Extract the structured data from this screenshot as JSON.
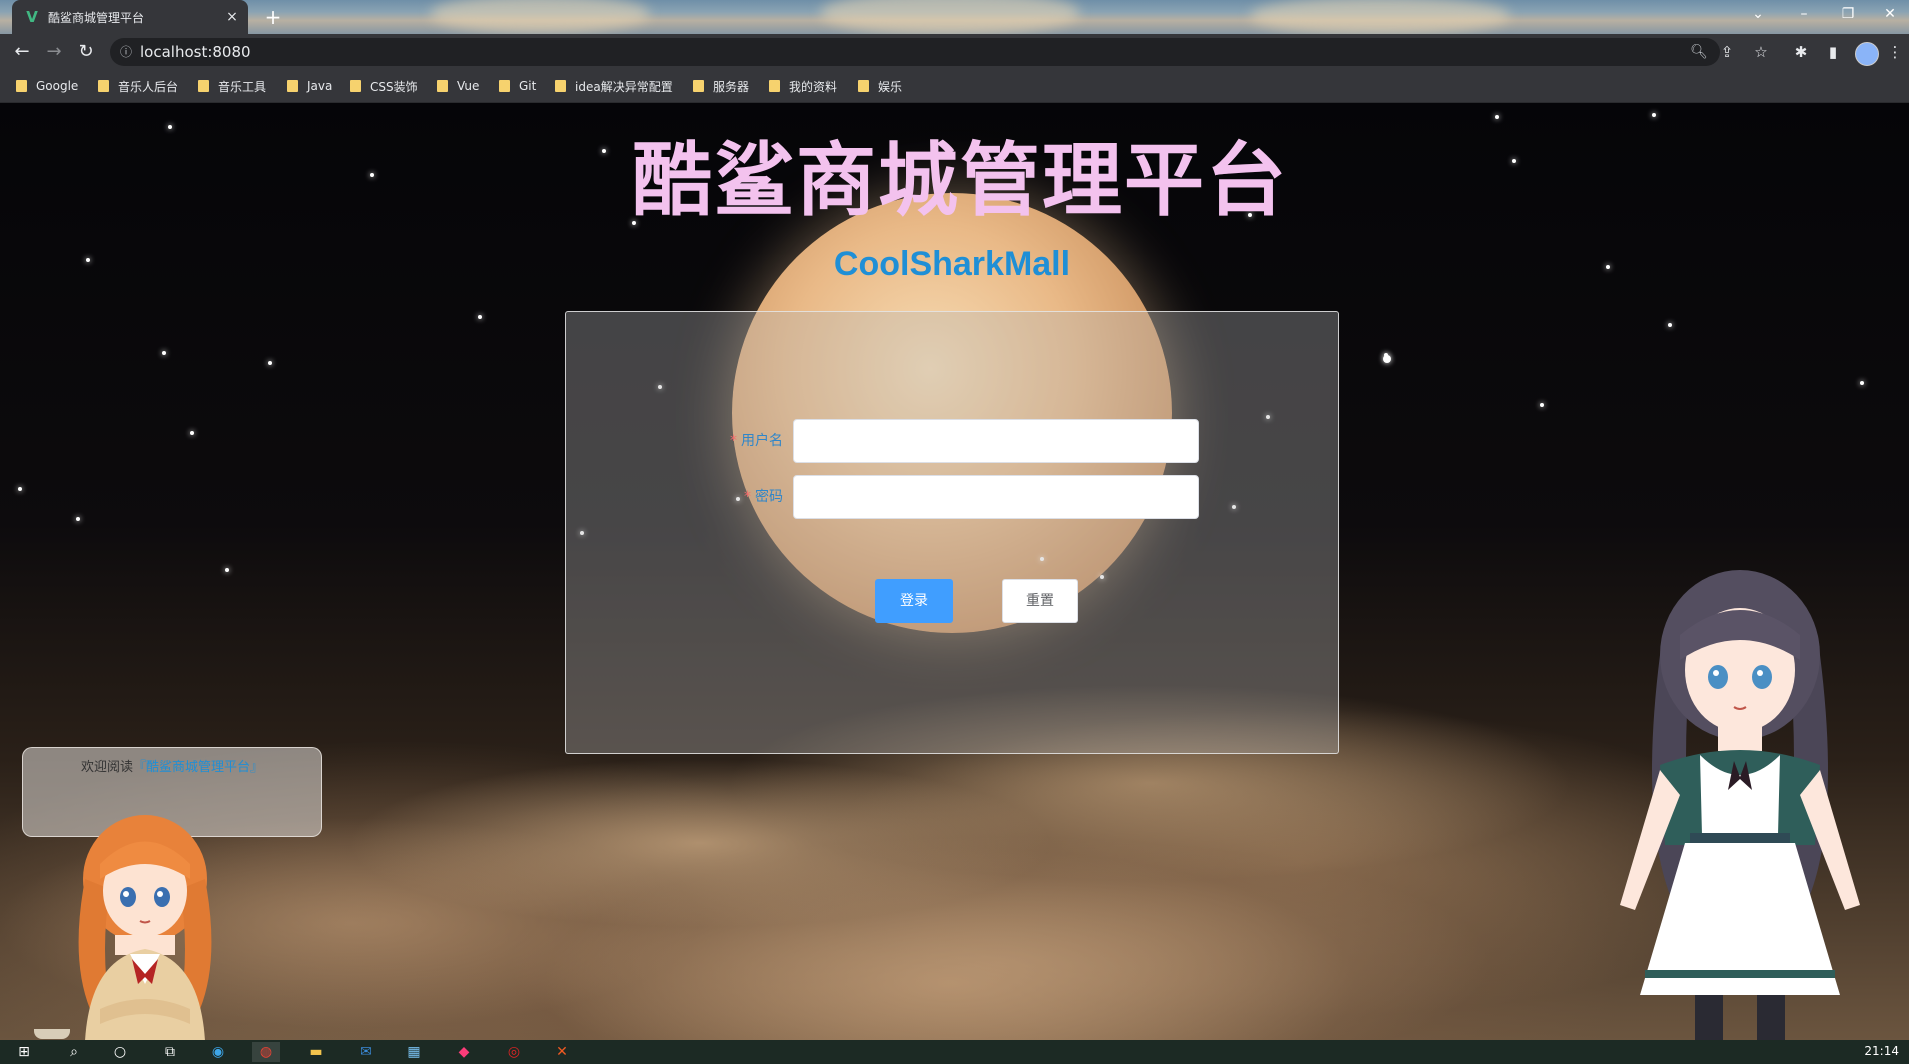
{
  "browser": {
    "tab_title": "酷鲨商城管理平台",
    "tab_close": "×",
    "new_tab": "+",
    "url": "localhost:8080",
    "bookmarks": [
      {
        "label": "Google"
      },
      {
        "label": "音乐人后台"
      },
      {
        "label": "音乐工具"
      },
      {
        "label": "Java"
      },
      {
        "label": "CSS装饰"
      },
      {
        "label": "Vue"
      },
      {
        "label": "Git"
      },
      {
        "label": "idea解决异常配置"
      },
      {
        "label": "服务器"
      },
      {
        "label": "我的资料"
      },
      {
        "label": "娱乐"
      }
    ]
  },
  "page": {
    "title": "酷鲨商城管理平台",
    "subtitle": "CoolSharkMall",
    "form": {
      "username_label": "用户名",
      "username_required": "*",
      "username_value": "",
      "password_label": "密码",
      "password_required": "*",
      "password_value": "",
      "login_button": "登录",
      "reset_button": "重置"
    },
    "widget": {
      "welcome_prefix": "欢迎阅读",
      "welcome_link": "『酷鲨商城管理平台』"
    }
  },
  "taskbar": {
    "clock": "21:14"
  },
  "colors": {
    "title": "#f3c2ee",
    "subtitle": "#1f8fd6",
    "primary_button": "#409eff",
    "required_mark": "#f56c6c"
  }
}
